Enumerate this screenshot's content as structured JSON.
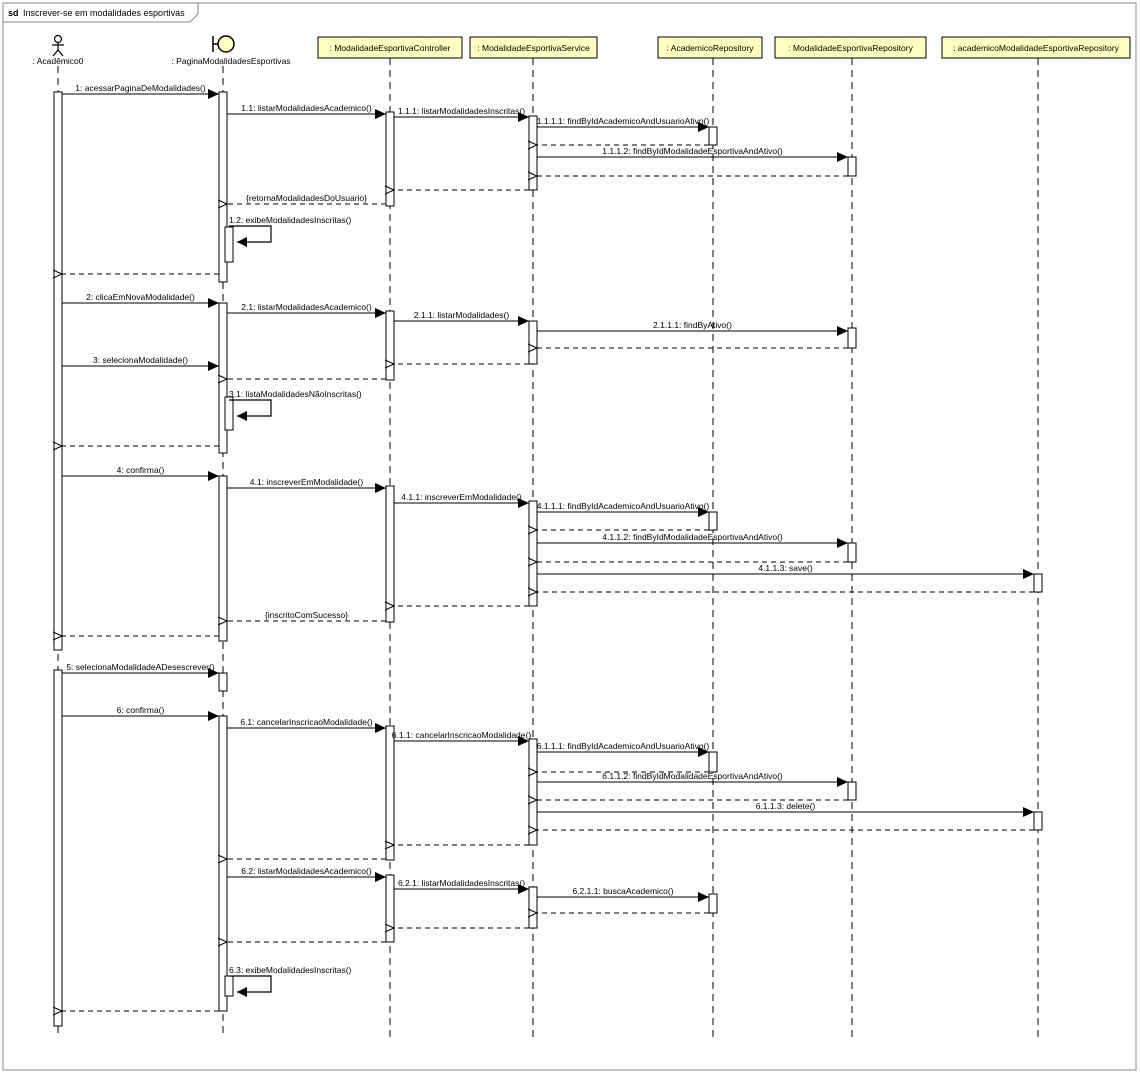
{
  "frame": {
    "keyword": "sd",
    "title": "Inscrever-se em modalidades esportivas"
  },
  "lifelines": [
    {
      "id": "actor",
      "label": ": Acadêmico0",
      "kind": "actor"
    },
    {
      "id": "page",
      "label": ": PaginaModalidadesEsportivas",
      "kind": "boundary"
    },
    {
      "id": "ctrl",
      "label": ": ModalidadeEsportivaController",
      "kind": "box"
    },
    {
      "id": "svc",
      "label": ": ModalidadeEsportivaService",
      "kind": "box"
    },
    {
      "id": "acadRepo",
      "label": ": AcademicoRepository",
      "kind": "box"
    },
    {
      "id": "modRepo",
      "label": ": ModalidadeEsportivaRepository",
      "kind": "box"
    },
    {
      "id": "amRepo",
      "label": ": academicoModalidadeEsportivaRepository",
      "kind": "box"
    }
  ],
  "messages": [
    {
      "from": "actor",
      "to": "page",
      "label": "1: acessarPaginaDeModalidades()",
      "type": "sync"
    },
    {
      "from": "page",
      "to": "ctrl",
      "label": "1.1: listarModalidadesAcademico()",
      "type": "sync"
    },
    {
      "from": "ctrl",
      "to": "svc",
      "label": "1.1.1: listarModalidadesInscritas()",
      "type": "sync"
    },
    {
      "from": "svc",
      "to": "acadRepo",
      "label": "1.1.1.1: findByIdAcademicoAndUsuarioAtivo()",
      "type": "sync"
    },
    {
      "from": "acadRepo",
      "to": "svc",
      "label": "",
      "type": "return"
    },
    {
      "from": "svc",
      "to": "modRepo",
      "label": "1.1.1.2: findByIdModalidadeEsportivaAndAtivo()",
      "type": "sync"
    },
    {
      "from": "modRepo",
      "to": "svc",
      "label": "",
      "type": "return"
    },
    {
      "from": "svc",
      "to": "ctrl",
      "label": "",
      "type": "return"
    },
    {
      "from": "ctrl",
      "to": "page",
      "label": "{retornaModalidadesDoUsuario}",
      "type": "return"
    },
    {
      "from": "page",
      "to": "page",
      "label": "1.2: exibeModalidadesInscritas()",
      "type": "self"
    },
    {
      "from": "page",
      "to": "actor",
      "label": "",
      "type": "return"
    },
    {
      "from": "actor",
      "to": "page",
      "label": "2: clicaEmNovaModalidade()",
      "type": "sync"
    },
    {
      "from": "page",
      "to": "ctrl",
      "label": "2.1: listarModalidadesAcademico()",
      "type": "sync"
    },
    {
      "from": "ctrl",
      "to": "svc",
      "label": "2.1.1: listarModalidades()",
      "type": "sync"
    },
    {
      "from": "svc",
      "to": "modRepo",
      "label": "2.1.1.1: findByAtivo()",
      "type": "sync"
    },
    {
      "from": "modRepo",
      "to": "svc",
      "label": "",
      "type": "return"
    },
    {
      "from": "svc",
      "to": "ctrl",
      "label": "",
      "type": "return"
    },
    {
      "from": "actor",
      "to": "page",
      "label": "3: selecionaModalidade()",
      "type": "sync"
    },
    {
      "from": "ctrl",
      "to": "page",
      "label": "",
      "type": "return"
    },
    {
      "from": "page",
      "to": "page",
      "label": "3.1: listaModalidadesNãoInscritas()",
      "type": "self"
    },
    {
      "from": "page",
      "to": "actor",
      "label": "",
      "type": "return"
    },
    {
      "from": "actor",
      "to": "page",
      "label": "4: confirma()",
      "type": "sync"
    },
    {
      "from": "page",
      "to": "ctrl",
      "label": "4.1: inscreverEmModalidade()",
      "type": "sync"
    },
    {
      "from": "ctrl",
      "to": "svc",
      "label": "4.1.1: inscreverEmModalidade()",
      "type": "sync"
    },
    {
      "from": "svc",
      "to": "acadRepo",
      "label": "4.1.1.1: findByIdAcademicoAndUsuarioAtivo()",
      "type": "sync"
    },
    {
      "from": "acadRepo",
      "to": "svc",
      "label": "",
      "type": "return"
    },
    {
      "from": "svc",
      "to": "modRepo",
      "label": "4.1.1.2: findByIdModalidadeEsportivaAndAtivo()",
      "type": "sync"
    },
    {
      "from": "modRepo",
      "to": "svc",
      "label": "",
      "type": "return"
    },
    {
      "from": "svc",
      "to": "amRepo",
      "label": "4.1.1.3: save()",
      "type": "sync"
    },
    {
      "from": "amRepo",
      "to": "svc",
      "label": "",
      "type": "return"
    },
    {
      "from": "svc",
      "to": "ctrl",
      "label": "",
      "type": "return"
    },
    {
      "from": "ctrl",
      "to": "page",
      "label": "{inscritoComSucesso}",
      "type": "return"
    },
    {
      "from": "page",
      "to": "actor",
      "label": "",
      "type": "return"
    },
    {
      "from": "actor",
      "to": "page",
      "label": "5: selecionaModalidadeADesescrever()",
      "type": "sync"
    },
    {
      "from": "actor",
      "to": "page",
      "label": "6: confirma()",
      "type": "sync"
    },
    {
      "from": "page",
      "to": "ctrl",
      "label": "6.1: cancelarInscricaoModalidade()",
      "type": "sync"
    },
    {
      "from": "ctrl",
      "to": "svc",
      "label": "6.1.1: cancelarInscricaoModalidade()",
      "type": "sync"
    },
    {
      "from": "svc",
      "to": "acadRepo",
      "label": "6.1.1.1: findByIdAcademicoAndUsuarioAtivo()",
      "type": "sync"
    },
    {
      "from": "acadRepo",
      "to": "svc",
      "label": "",
      "type": "return"
    },
    {
      "from": "svc",
      "to": "modRepo",
      "label": "6.1.1.2: findByIdModalidadeEsportivaAndAtivo()",
      "type": "sync"
    },
    {
      "from": "modRepo",
      "to": "svc",
      "label": "",
      "type": "return"
    },
    {
      "from": "svc",
      "to": "amRepo",
      "label": "6.1.1.3: delete()",
      "type": "sync"
    },
    {
      "from": "amRepo",
      "to": "svc",
      "label": "",
      "type": "return"
    },
    {
      "from": "svc",
      "to": "ctrl",
      "label": "",
      "type": "return"
    },
    {
      "from": "ctrl",
      "to": "page",
      "label": "",
      "type": "return"
    },
    {
      "from": "page",
      "to": "ctrl",
      "label": "6.2: listarModalidadesAcademico()",
      "type": "sync"
    },
    {
      "from": "ctrl",
      "to": "svc",
      "label": "6.2.1: listarModalidadesInscritas()",
      "type": "sync"
    },
    {
      "from": "svc",
      "to": "acadRepo",
      "label": "6.2.1.1: buscaAcademico()",
      "type": "sync"
    },
    {
      "from": "acadRepo",
      "to": "svc",
      "label": "",
      "type": "return"
    },
    {
      "from": "svc",
      "to": "ctrl",
      "label": "",
      "type": "return"
    },
    {
      "from": "ctrl",
      "to": "page",
      "label": "",
      "type": "return"
    },
    {
      "from": "page",
      "to": "page",
      "label": "6.3: exibeModalidadesInscritas()",
      "type": "self"
    },
    {
      "from": "page",
      "to": "actor",
      "label": "",
      "type": "return"
    }
  ],
  "colors": {
    "participant_fill": "#ffffc0",
    "boundary_fill": "#ffffc0",
    "activation_fill": "#ffffff",
    "line": "#000000",
    "frame_border": "#888888",
    "title_tab_fill": "#ffffff"
  }
}
